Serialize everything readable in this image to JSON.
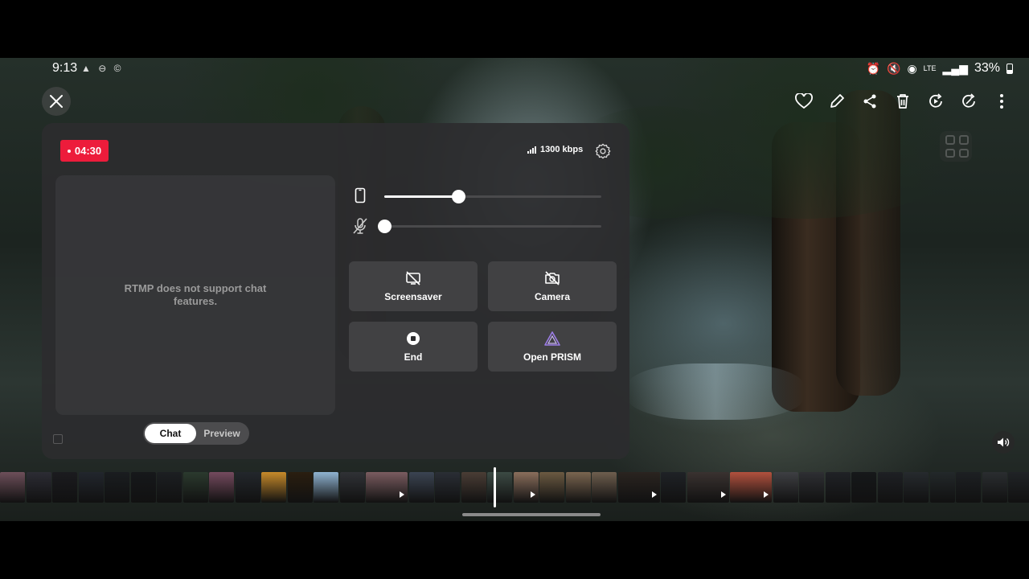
{
  "status_bar": {
    "time": "9:13",
    "left_icons": "▲ ⊖ ©",
    "battery": "33%",
    "network": "LTE"
  },
  "live": {
    "timer": "04:30",
    "bitrate": "1300 kbps"
  },
  "chat": {
    "message": "RTMP does not support chat features.",
    "tabs": [
      "Chat",
      "Preview"
    ],
    "active_tab": "Chat"
  },
  "sliders": {
    "device_volume": 0.34,
    "mic_volume": 0.0
  },
  "controls": {
    "screensaver": "Screensaver",
    "camera": "Camera",
    "end": "End",
    "open_prism": "Open PRISM"
  },
  "top_actions": [
    "heart-icon",
    "pencil-icon",
    "share-icon",
    "trash-icon",
    "replay-icon",
    "rotate-icon",
    "more-icon"
  ],
  "colors": {
    "live_badge": "#ed1c3b",
    "panel_bg": "#2c2c2e",
    "prism_accent": "#9b7ce6"
  },
  "filmstrip": {
    "thumbnails": [
      {
        "color": "#6d4f5a",
        "video": false
      },
      {
        "color": "#2c2c34",
        "video": false
      },
      {
        "color": "#1b1b1f",
        "video": false
      },
      {
        "color": "#22262d",
        "video": false
      },
      {
        "color": "#1a1d20",
        "video": false
      },
      {
        "color": "#16181b",
        "video": false
      },
      {
        "color": "#1c1f22",
        "video": false
      },
      {
        "color": "#2b3a2e",
        "video": false
      },
      {
        "color": "#744a5e",
        "video": false
      },
      {
        "color": "#23272c",
        "video": false
      },
      {
        "color": "#c78a2a",
        "video": false
      },
      {
        "color": "#2a1e10",
        "video": false
      },
      {
        "color": "#8fb3d1",
        "video": false
      },
      {
        "color": "#303236",
        "video": false
      },
      {
        "color": "#7a5c60",
        "video": true
      },
      {
        "color": "#3b4452",
        "video": false
      },
      {
        "color": "#2a2e35",
        "video": false
      },
      {
        "color": "#4a3d35",
        "video": false
      },
      {
        "color": "#3c4a44",
        "video": false
      },
      {
        "color": "#8a6e5c",
        "video": true
      },
      {
        "color": "#6b5a42",
        "video": false
      },
      {
        "color": "#7a6550",
        "video": false
      },
      {
        "color": "#6e5e4e",
        "video": false
      },
      {
        "color": "#2a2420",
        "video": true
      },
      {
        "color": "#1f2226",
        "video": false
      },
      {
        "color": "#3a3230",
        "video": true
      },
      {
        "color": "#b2513e",
        "video": true
      },
      {
        "color": "#3e3f43",
        "video": false
      },
      {
        "color": "#2e2f33",
        "video": false
      },
      {
        "color": "#202226",
        "video": false
      },
      {
        "color": "#16181a",
        "video": false
      },
      {
        "color": "#1e2024",
        "video": false
      },
      {
        "color": "#262a2e",
        "video": false
      },
      {
        "color": "#23282a",
        "video": false
      },
      {
        "color": "#1d2023",
        "video": false
      },
      {
        "color": "#2a2d30",
        "video": false
      },
      {
        "color": "#202326",
        "video": false
      }
    ]
  }
}
